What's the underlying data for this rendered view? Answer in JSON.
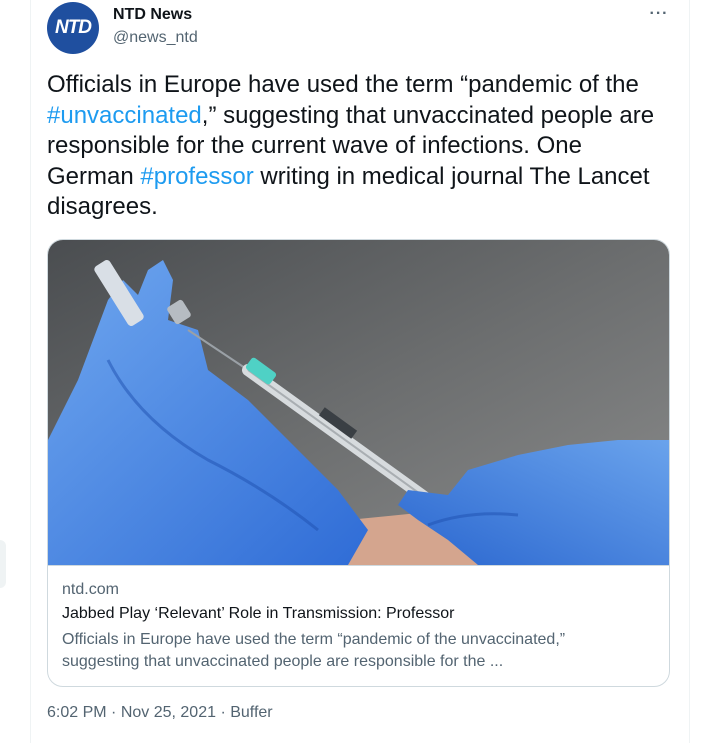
{
  "tweet": {
    "avatar": {
      "label": "NTD",
      "icon": "ntd-logo-avatar",
      "color": "#1f4f9f"
    },
    "display_name": "NTD News",
    "handle": "@news_ntd",
    "more_label": "···",
    "text": {
      "part1": "Officials in Europe have used the term “pandemic of the ",
      "hashtag1": "#unvaccinated",
      "part2": ",” suggesting that unvaccinated people are responsible for the current wave of infections. One German ",
      "hashtag2": "#professor",
      "part3": " writing in medical journal The Lancet disagrees."
    },
    "hashtag_color": "#1d9bf0",
    "card": {
      "image": "gloved-hands-holding-syringe-and-vaccine-vial",
      "domain": "ntd.com",
      "title": "Jabbed Play ‘Relevant’ Role in Transmission: Professor",
      "description": "Officials in Europe have used the term “pandemic of the unvaccinated,” suggesting that unvaccinated people are responsible for the ..."
    },
    "meta": {
      "time": "6:02 PM",
      "separator": " · ",
      "date": "Nov 25, 2021",
      "source": "Buffer"
    }
  }
}
